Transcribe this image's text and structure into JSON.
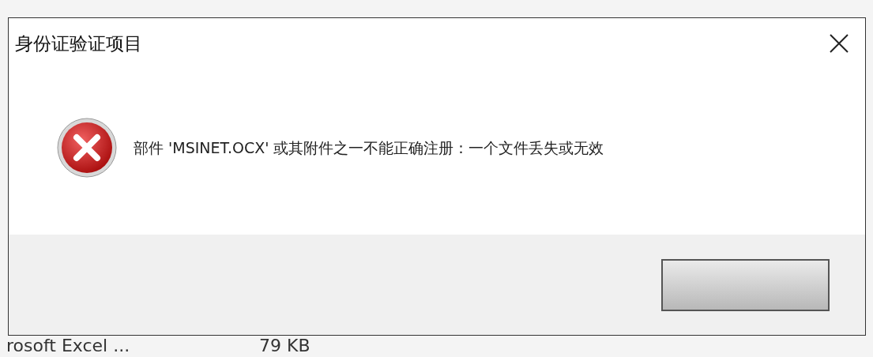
{
  "dialog": {
    "title": "身份证验证项目",
    "message": "部件 'MSINET.OCX' 或其附件之一不能正确注册：一个文件丢失或无效",
    "buttons": [
      {
        "kind": "default"
      }
    ]
  },
  "background_row": {
    "name": "rosoft Excel ...",
    "size": "79 KB"
  }
}
